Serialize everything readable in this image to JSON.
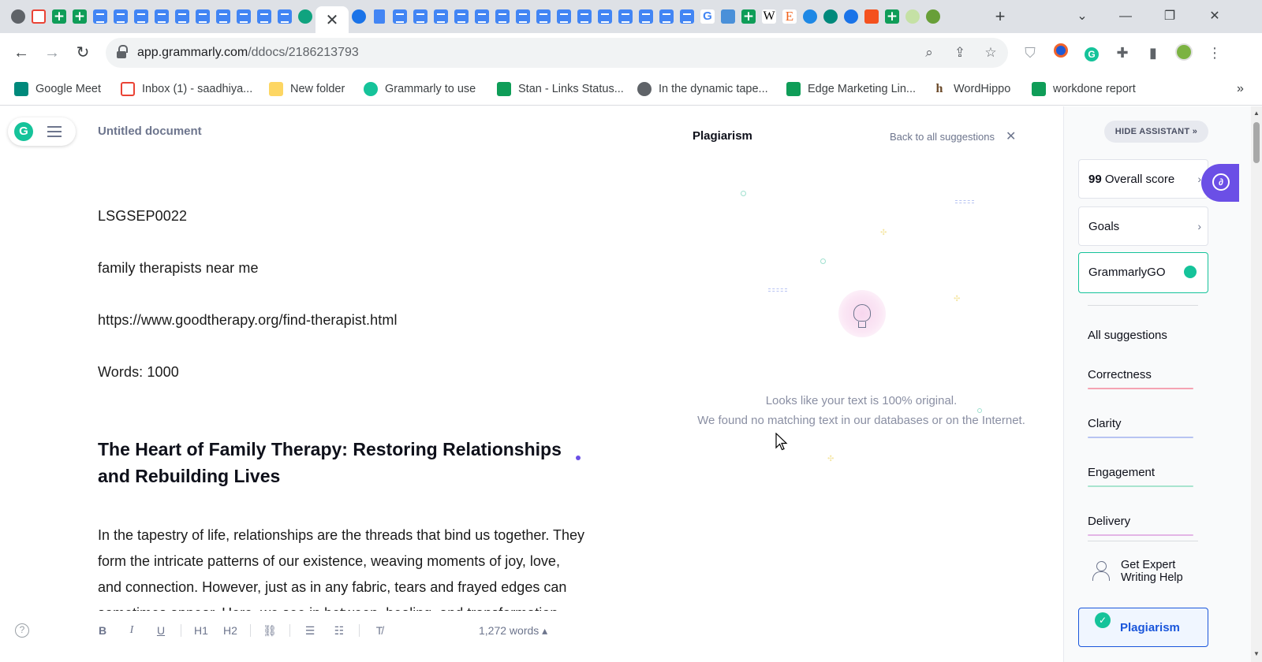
{
  "browser": {
    "active_tab_close": "✕",
    "new_tab": "+",
    "url_host": "app.grammarly.com",
    "url_path": "/ddocs/2186213793",
    "window_controls": {
      "list": "⌄",
      "minimize": "—",
      "restore": "❐",
      "close": "✕"
    }
  },
  "bookmarks": [
    {
      "label": "Google Meet",
      "icon": "google-meet-icon",
      "color": "#00897b"
    },
    {
      "label": "Inbox (1) - saadhiya...",
      "icon": "gmail-icon",
      "color": "#ea4335"
    },
    {
      "label": "New folder",
      "icon": "folder-icon",
      "color": "#fdd663"
    },
    {
      "label": "Grammarly to use",
      "icon": "grammarly-icon",
      "color": "#15c39a"
    },
    {
      "label": "Stan - Links Status...",
      "icon": "sheets-icon",
      "color": "#0f9d58"
    },
    {
      "label": "In the dynamic tape...",
      "icon": "globe-icon",
      "color": "#5f6368"
    },
    {
      "label": "Edge Marketing Lin...",
      "icon": "sheets-icon",
      "color": "#0f9d58"
    },
    {
      "label": "WordHippo",
      "icon": "wordhippo-icon",
      "color": "#6b4a2a"
    },
    {
      "label": "workdone report",
      "icon": "sheets-icon",
      "color": "#0f9d58"
    }
  ],
  "editor": {
    "doc_title": "Untitled document",
    "lines": [
      "LSGSEP0022",
      "family therapists near me",
      "https://www.goodtherapy.org/find-therapist.html",
      "Words:  1000"
    ],
    "heading": "The Heart of Family Therapy: Restoring Relationships and Rebuilding Lives",
    "body": "In the tapestry of life, relationships are the threads that bind us together. They form the intricate patterns of our existence, weaving moments of joy, love, and connection. However, just as in any fabric, tears and frayed edges can sometimes appear. Here, we see in between, healing, and transformation, within the family unit."
  },
  "format_bar": {
    "help": "?",
    "bold": "B",
    "italic": "I",
    "underline": "U",
    "h1": "H1",
    "h2": "H2",
    "word_count": "1,272 words ▴"
  },
  "plagiarism": {
    "title": "Plagiarism",
    "back_link": "Back to all suggestions",
    "close": "✕",
    "message_line1": "Looks like your text is 100% original.",
    "message_line2": "We found no matching text in our databases or on the Internet."
  },
  "assistant": {
    "hide_button": "HIDE ASSISTANT »",
    "score_value": "99",
    "score_label": "Overall score",
    "goals": "Goals",
    "grammarly_go": "GrammarlyGO",
    "all_suggestions": "All suggestions",
    "categories": [
      {
        "label": "Correctness",
        "color": "#f5a3b3"
      },
      {
        "label": "Clarity",
        "color": "#b8c4f2"
      },
      {
        "label": "Engagement",
        "color": "#a9e4cf"
      },
      {
        "label": "Delivery",
        "color": "#e3b5e6"
      }
    ],
    "expert_help": "Get Expert Writing Help",
    "plagiarism": "Plagiarism"
  }
}
